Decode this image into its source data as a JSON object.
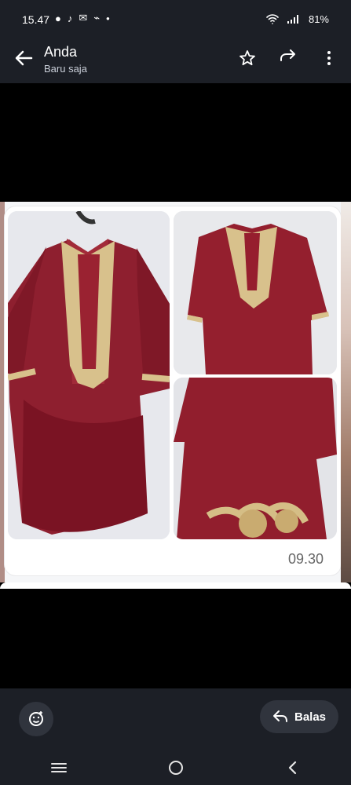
{
  "status": {
    "time": "15.47",
    "battery": "81%"
  },
  "header": {
    "title": "Anda",
    "subtitle": "Baru saja"
  },
  "message": {
    "time": "09.30"
  },
  "actions": {
    "reply_label": "Balas"
  }
}
